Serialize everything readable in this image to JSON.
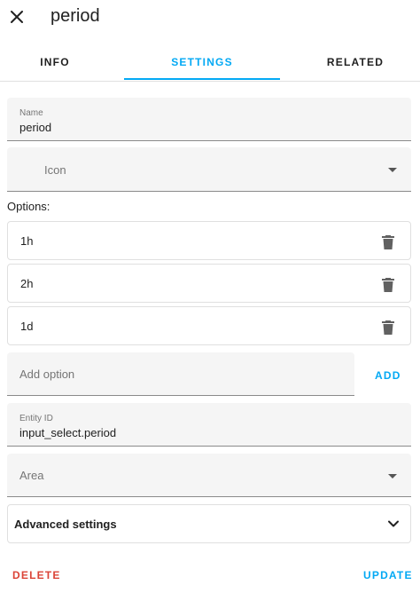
{
  "dialog": {
    "title": "period",
    "close_icon": "close-icon"
  },
  "tabs": [
    {
      "label": "INFO",
      "active": false
    },
    {
      "label": "SETTINGS",
      "active": true
    },
    {
      "label": "RELATED",
      "active": false
    }
  ],
  "form": {
    "name": {
      "label": "Name",
      "value": "period"
    },
    "icon": {
      "placeholder": "Icon"
    },
    "options_label": "Options:",
    "options": [
      {
        "value": "1h"
      },
      {
        "value": "2h"
      },
      {
        "value": "1d"
      }
    ],
    "add_option": {
      "placeholder": "Add option",
      "add_label": "ADD"
    },
    "entity_id": {
      "label": "Entity ID",
      "value": "input_select.period"
    },
    "area": {
      "placeholder": "Area"
    },
    "advanced": {
      "label": "Advanced settings"
    }
  },
  "footer": {
    "delete_label": "DELETE",
    "update_label": "UPDATE"
  },
  "colors": {
    "accent": "#03a9f4",
    "danger": "#db4437",
    "field_bg": "#f5f5f5"
  }
}
